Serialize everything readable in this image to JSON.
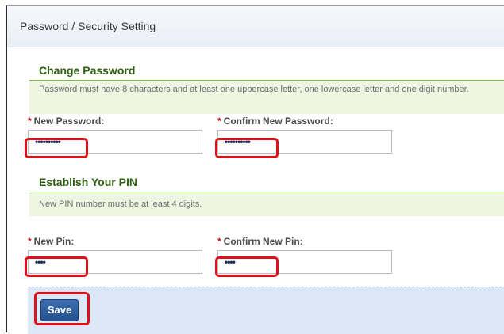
{
  "window": {
    "title": "Password / Security Setting"
  },
  "change_password": {
    "heading": "Change Password",
    "note": "Password must have 8 characters and at least one uppercase letter, one lowercase letter and one digit number.",
    "new_password": {
      "required_marker": "*",
      "label": "New Password:",
      "value": "••••••••••"
    },
    "confirm_password": {
      "required_marker": "*",
      "label": "Confirm New Password:",
      "value": "••••••••••"
    }
  },
  "pin": {
    "heading": "Establish Your PIN",
    "note": "New PIN number must be at least 4 digits.",
    "new_pin": {
      "required_marker": "*",
      "label": "New Pin:",
      "value": "••••"
    },
    "confirm_pin": {
      "required_marker": "*",
      "label": "Confirm New Pin:",
      "value": "••••"
    }
  },
  "actions": {
    "save_label": "Save"
  },
  "colors": {
    "section_heading": "#2d5e12",
    "note_background": "#eef6e2",
    "highlight": "#e0101a",
    "save_button": "#2f5ea0",
    "footer": "#dce8f6"
  }
}
